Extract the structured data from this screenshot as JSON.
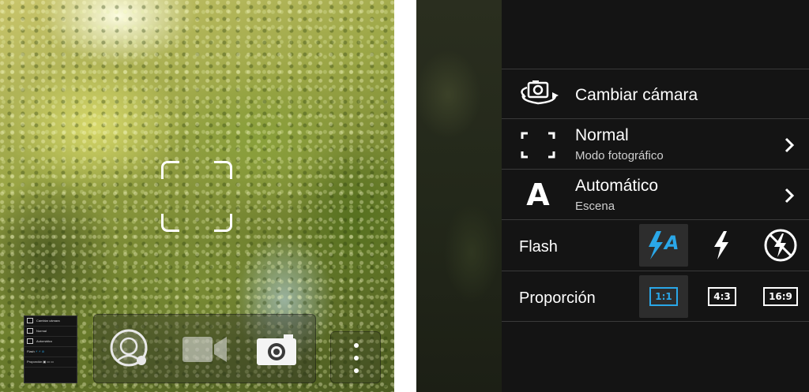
{
  "camera": {
    "thumbnail": {
      "rows": [
        "Cambiar cámara",
        "Normal",
        "Automático",
        "Flash",
        "Proporción"
      ]
    },
    "modes": [
      {
        "icon": "selfie-face-icon"
      },
      {
        "icon": "video-camera-icon"
      },
      {
        "icon": "photo-camera-icon"
      }
    ],
    "more_icon": "more-dots-icon"
  },
  "settings": {
    "switch_camera": {
      "label": "Cambiar cámara",
      "icon": "switch-camera-icon"
    },
    "shooting_mode": {
      "title": "Normal",
      "subtitle": "Modo fotográfico",
      "icon": "frame-brackets-icon"
    },
    "scene": {
      "title": "Automático",
      "subtitle": "Escena",
      "glyph": "A"
    },
    "flash": {
      "label": "Flash",
      "options": [
        {
          "icon": "flash-auto-icon",
          "glyph": "A",
          "selected": true
        },
        {
          "icon": "flash-on-icon",
          "selected": false
        },
        {
          "icon": "flash-off-icon",
          "selected": false
        }
      ]
    },
    "aspect_ratio": {
      "label": "Proporción",
      "options": [
        {
          "label": "1:1",
          "selected": true
        },
        {
          "label": "4:3",
          "selected": false
        },
        {
          "label": "16:9",
          "selected": false
        }
      ]
    }
  },
  "colors": {
    "accent": "#2aa7e8",
    "panel_bg": "#141414",
    "selected_bg": "#2d2d2d"
  }
}
